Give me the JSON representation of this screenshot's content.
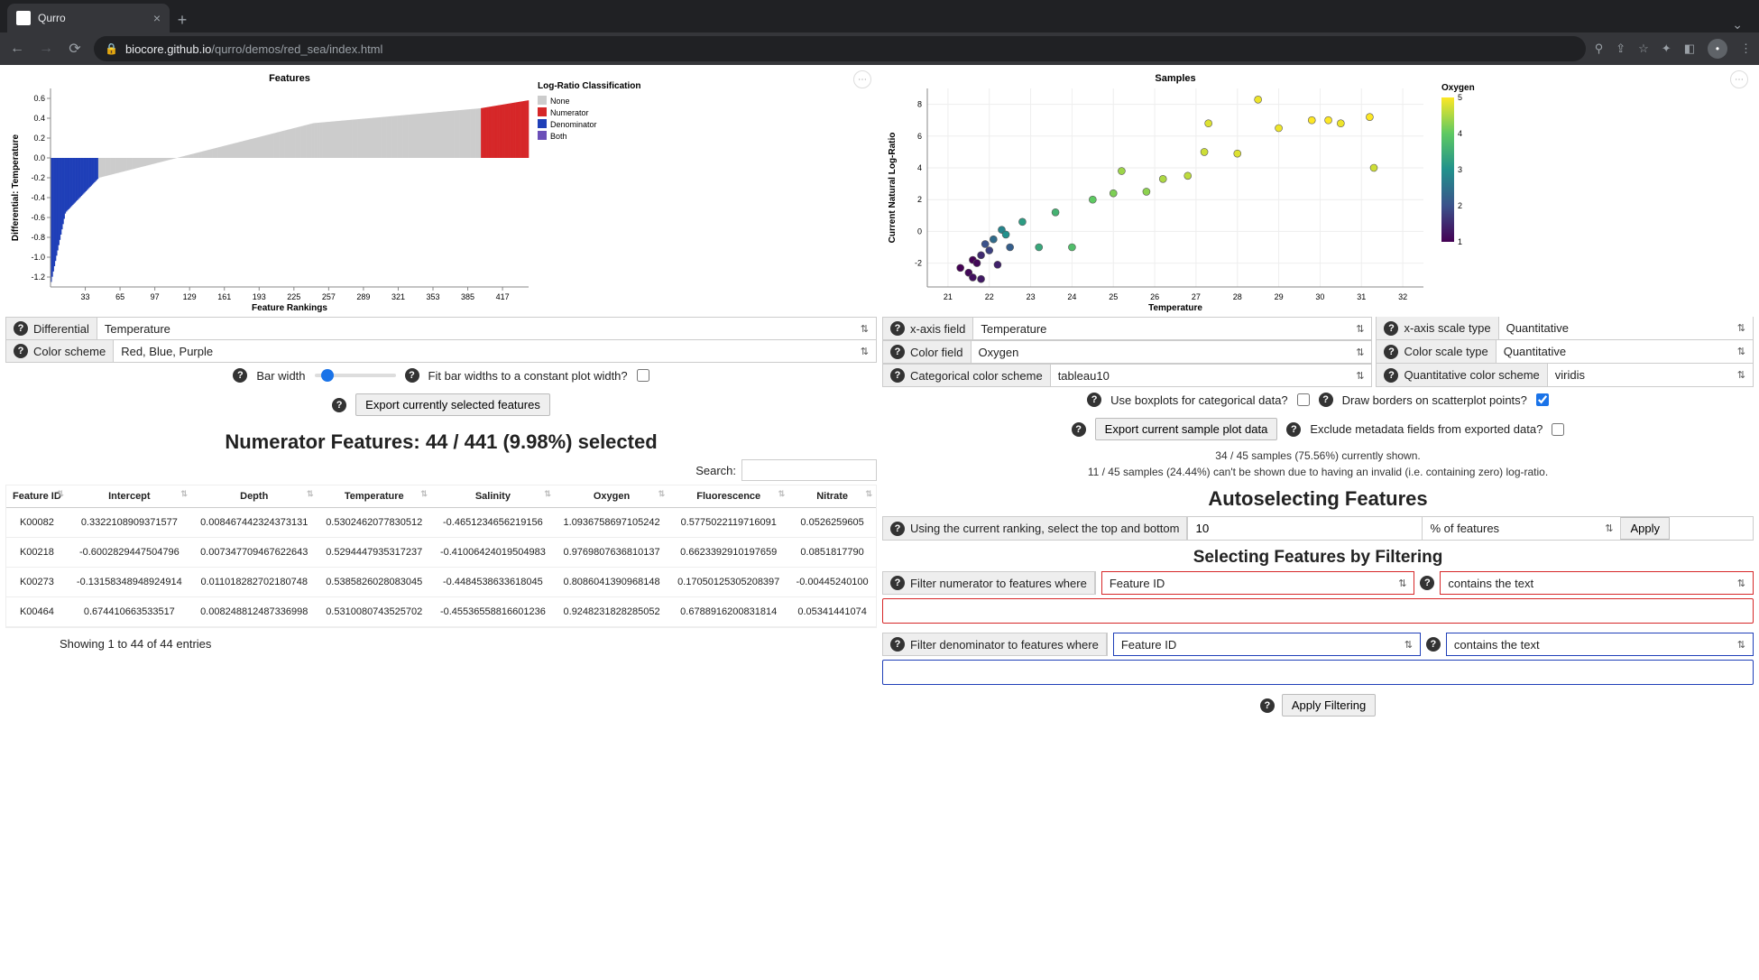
{
  "browser": {
    "tab_title": "Qurro",
    "host": "biocore.github.io",
    "path": "/qurro/demos/red_sea/index.html"
  },
  "left": {
    "plot_title": "Features",
    "ylabel": "Differential: Temperature",
    "xlabel": "Feature Rankings",
    "legend_title": "Log-Ratio Classification",
    "legend": [
      "None",
      "Numerator",
      "Denominator",
      "Both"
    ],
    "yticks": [
      "0.6",
      "0.4",
      "0.2",
      "0.0",
      "-0.2",
      "-0.4",
      "-0.6",
      "-0.8",
      "-1.0",
      "-1.2"
    ],
    "xticks": [
      "33",
      "65",
      "97",
      "129",
      "161",
      "193",
      "225",
      "257",
      "289",
      "321",
      "353",
      "385",
      "417"
    ],
    "differential_label": "Differential",
    "differential_value": "Temperature",
    "color_scheme_label": "Color scheme",
    "color_scheme_value": "Red, Blue, Purple",
    "bar_width_label": "Bar width",
    "fit_label": "Fit bar widths to a constant plot width?",
    "export_btn": "Export currently selected features",
    "selected_heading": "Numerator Features: 44 / 441 (9.98%) selected",
    "search_label": "Search:",
    "columns": [
      "Feature ID",
      "Intercept",
      "Depth",
      "Temperature",
      "Salinity",
      "Oxygen",
      "Fluorescence",
      "Nitrate"
    ],
    "rows": [
      [
        "K00082",
        "0.3322108909371577",
        "0.008467442324373131",
        "0.5302462077830512",
        "-0.4651234656219156",
        "1.0936758697105242",
        "0.5775022119716091",
        "0.0526259605"
      ],
      [
        "K00218",
        "-0.6002829447504796",
        "0.007347709467622643",
        "0.5294447935317237",
        "-0.41006424019504983",
        "0.9769807636810137",
        "0.6623392910197659",
        "0.0851817790"
      ],
      [
        "K00273",
        "-0.13158348948924914",
        "0.011018282702180748",
        "0.5385826028083045",
        "-0.4484538633618045",
        "0.8086041390968148",
        "0.17050125305208397",
        "-0.00445240100"
      ],
      [
        "K00464",
        "0.674410663533517",
        "0.008248812487336998",
        "0.5310080743525702",
        "-0.45536558816601236",
        "0.9248231828285052",
        "0.6788916200831814",
        "0.05341441074"
      ]
    ],
    "showing": "Showing 1 to 44 of 44 entries"
  },
  "right": {
    "plot_title": "Samples",
    "ylabel": "Current Natural Log-Ratio",
    "xlabel": "Temperature",
    "color_title": "Oxygen",
    "color_ticks": [
      "5",
      "4",
      "3",
      "2",
      "1"
    ],
    "xticks": [
      "21",
      "22",
      "23",
      "24",
      "25",
      "26",
      "27",
      "28",
      "29",
      "30",
      "31",
      "32"
    ],
    "yticks": [
      "8",
      "6",
      "4",
      "2",
      "0",
      "-2"
    ],
    "xfield_label": "x-axis field",
    "xfield_value": "Temperature",
    "xscale_label": "x-axis scale type",
    "xscale_value": "Quantitative",
    "cfield_label": "Color field",
    "cfield_value": "Oxygen",
    "cscale_label": "Color scale type",
    "cscale_value": "Quantitative",
    "catcolor_label": "Categorical color scheme",
    "catcolor_value": "tableau10",
    "quantcolor_label": "Quantitative color scheme",
    "quantcolor_value": "viridis",
    "boxplot_label": "Use boxplots for categorical data?",
    "borders_label": "Draw borders on scatterplot points?",
    "export_btn": "Export current sample plot data",
    "exclude_label": "Exclude metadata fields from exported data?",
    "shown_status": "34 / 45 samples (75.56%) currently shown.",
    "invalid_status": "11 / 45 samples (24.44%) can't be shown due to having an invalid (i.e. containing zero) log-ratio.",
    "auto_heading": "Autoselecting Features",
    "auto_label": "Using the current ranking, select the top and bottom",
    "auto_value": "10",
    "auto_unit": "% of features",
    "apply_btn": "Apply",
    "filter_heading": "Selecting Features by Filtering",
    "num_filter_label": "Filter numerator to features where",
    "den_filter_label": "Filter denominator to features where",
    "filter_field": "Feature ID",
    "filter_op": "contains the text",
    "apply_filter_btn": "Apply Filtering"
  },
  "chart_data": [
    {
      "type": "bar",
      "title": "Features",
      "xlabel": "Feature Rankings",
      "ylabel": "Differential: Temperature",
      "xlim": [
        1,
        441
      ],
      "ylim": [
        -1.3,
        0.7
      ],
      "legend": {
        "title": "Log-Ratio Classification",
        "entries": [
          "None",
          "Numerator",
          "Denominator",
          "Both"
        ],
        "colors": [
          "#cccccc",
          "#d62728",
          "#1f3fb8",
          "#6b4fb8"
        ]
      },
      "note": "Sorted bar of 441 features by Temperature differential. Bars ~1–44 colored Denominator (blue, values ≈ -1.25 to 0.0), bars ~398–441 colored Numerator (red, values ≈ 0.5–0.6), remainder None (grey) spanning ≈ -0.5 to 0.5."
    },
    {
      "type": "scatter",
      "title": "Samples",
      "xlabel": "Temperature",
      "ylabel": "Current Natural Log-Ratio",
      "color": {
        "field": "Oxygen",
        "scale": "viridis",
        "range": [
          1,
          5
        ]
      },
      "xlim": [
        21,
        32
      ],
      "ylim": [
        -3,
        9
      ],
      "series": [
        {
          "name": "samples",
          "points": [
            {
              "x": 21.3,
              "y": -2.3,
              "c": 1.0
            },
            {
              "x": 21.5,
              "y": -2.6,
              "c": 1.1
            },
            {
              "x": 21.6,
              "y": -2.9,
              "c": 1.2
            },
            {
              "x": 21.6,
              "y": -1.8,
              "c": 1.0
            },
            {
              "x": 21.7,
              "y": -2.0,
              "c": 1.1
            },
            {
              "x": 21.8,
              "y": -3.0,
              "c": 1.3
            },
            {
              "x": 21.8,
              "y": -1.5,
              "c": 1.5
            },
            {
              "x": 21.9,
              "y": -0.8,
              "c": 2.0
            },
            {
              "x": 22.0,
              "y": -1.2,
              "c": 1.8
            },
            {
              "x": 22.1,
              "y": -0.5,
              "c": 2.4
            },
            {
              "x": 22.2,
              "y": -2.1,
              "c": 1.4
            },
            {
              "x": 22.3,
              "y": 0.1,
              "c": 2.8
            },
            {
              "x": 22.4,
              "y": -0.2,
              "c": 3.0
            },
            {
              "x": 22.5,
              "y": -1.0,
              "c": 2.2
            },
            {
              "x": 22.8,
              "y": 0.6,
              "c": 3.2
            },
            {
              "x": 23.2,
              "y": -1.0,
              "c": 3.4
            },
            {
              "x": 23.6,
              "y": 1.2,
              "c": 3.6
            },
            {
              "x": 24.0,
              "y": -1.0,
              "c": 3.8
            },
            {
              "x": 24.5,
              "y": 2.0,
              "c": 4.0
            },
            {
              "x": 25.0,
              "y": 2.4,
              "c": 4.2
            },
            {
              "x": 25.2,
              "y": 3.8,
              "c": 4.4
            },
            {
              "x": 25.8,
              "y": 2.5,
              "c": 4.3
            },
            {
              "x": 26.2,
              "y": 3.3,
              "c": 4.5
            },
            {
              "x": 26.8,
              "y": 3.5,
              "c": 4.6
            },
            {
              "x": 27.2,
              "y": 5.0,
              "c": 4.7
            },
            {
              "x": 27.3,
              "y": 6.8,
              "c": 4.8
            },
            {
              "x": 28.0,
              "y": 4.9,
              "c": 4.8
            },
            {
              "x": 28.5,
              "y": 8.3,
              "c": 4.9
            },
            {
              "x": 29.0,
              "y": 6.5,
              "c": 4.9
            },
            {
              "x": 29.8,
              "y": 7.0,
              "c": 5.0
            },
            {
              "x": 30.2,
              "y": 7.0,
              "c": 5.0
            },
            {
              "x": 30.5,
              "y": 6.8,
              "c": 4.9
            },
            {
              "x": 31.2,
              "y": 7.2,
              "c": 5.0
            },
            {
              "x": 31.3,
              "y": 4.0,
              "c": 4.7
            }
          ]
        }
      ]
    }
  ]
}
